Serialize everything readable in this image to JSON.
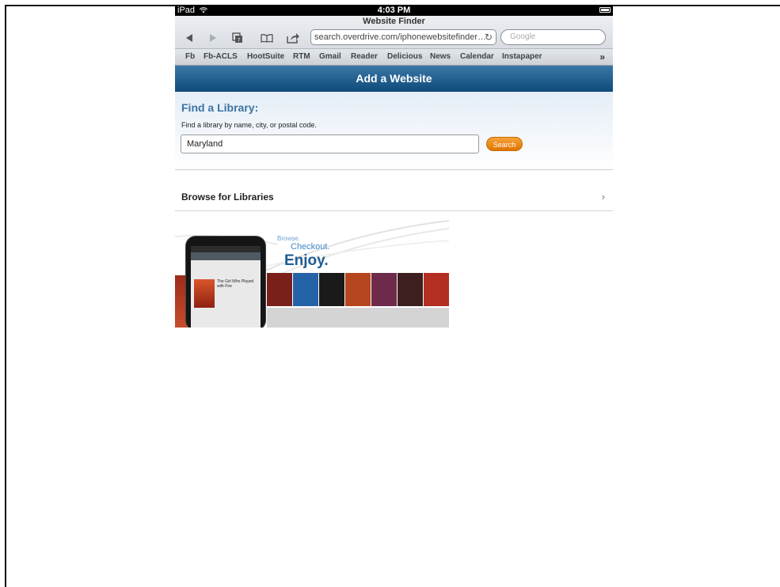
{
  "status_bar": {
    "device": "iPad",
    "time": "4:03 PM"
  },
  "browser": {
    "page_title": "Website Finder",
    "url": "search.overdrive.com/iphonewebsitefinder…",
    "search_placeholder": "Google",
    "bookmarks": [
      "Fb",
      "Fb-ACLS",
      "HootSuite",
      "RTM",
      "Gmail",
      "Reader",
      "Delicious",
      "News",
      "Calendar",
      "Instapaper"
    ],
    "more_label": "»"
  },
  "header": {
    "title": "Add a Website"
  },
  "find": {
    "title": "Find a Library:",
    "subtitle": "Find a library by name, city, or postal code.",
    "input_value": "Maryland",
    "search_label": "Search"
  },
  "browse": {
    "label": "Browse for Libraries",
    "chevron": "›"
  },
  "promo": {
    "line1": "Browse.",
    "line2": "Checkout.",
    "line3": "Enjoy.",
    "book_title": "The Girl Who Played with Fire"
  },
  "colors": {
    "header_blue": "#1b5686",
    "search_orange": "#f08a10",
    "find_title": "#3c74a3"
  }
}
